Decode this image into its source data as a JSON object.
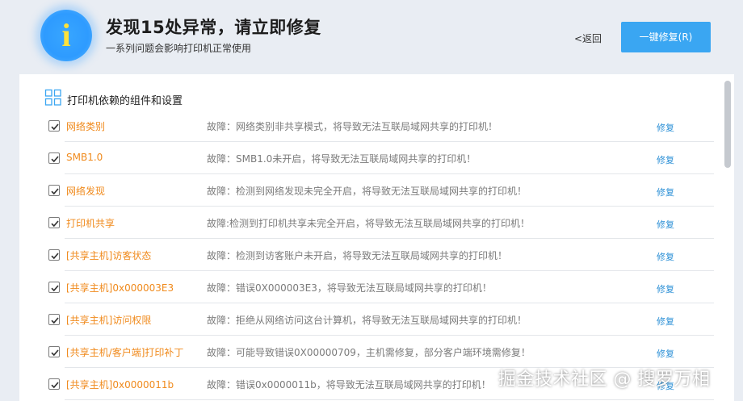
{
  "header": {
    "icon": "info-icon",
    "icon_glyph": "i",
    "title": "发现15处异常，请立即修复",
    "subtitle": "一系列问题会影响打印机正常使用",
    "back_label": "<返回",
    "fix_all_label": "一键修复(R)"
  },
  "section": {
    "icon": "grid-icon",
    "title": "打印机依赖的组件和设置"
  },
  "items": [
    {
      "name": "网络类别",
      "desc": "故障：网络类别非共享模式，将导致无法互联局域网共享的打印机！",
      "fix": "修复",
      "checked": true
    },
    {
      "name": "SMB1.0",
      "desc": "故障：SMB1.0未开启，将导致无法互联局域网共享的打印机！",
      "fix": "修复",
      "checked": true
    },
    {
      "name": "网络发现",
      "desc": "故障：检测到网络发现未完全开启，将导致无法互联局域网共享的打印机！",
      "fix": "修复",
      "checked": true
    },
    {
      "name": "打印机共享",
      "desc": "故障:检测到打印机共享未完全开启，将导致无法互联局域网共享的打印机！",
      "fix": "修复",
      "checked": true
    },
    {
      "name": "[共享主机]访客状态",
      "desc": "故障：检测到访客账户未开启，将导致无法互联局域网共享的打印机！",
      "fix": "修复",
      "checked": true
    },
    {
      "name": "[共享主机]0x000003E3",
      "desc": "故障：错误0X000003E3，将导致无法互联局域网共享的打印机！",
      "fix": "修复",
      "checked": true
    },
    {
      "name": "[共享主机]访问权限",
      "desc": "故障：拒绝从网络访问这台计算机，将导致无法互联局域网共享的打印机！",
      "fix": "修复",
      "checked": true
    },
    {
      "name": "[共享主机/客户端]打印补丁",
      "desc": "故障：可能导致错误0X00000709，主机需修复，部分客户端环境需修复！",
      "fix": "修复",
      "checked": true
    },
    {
      "name": "[共享主机]0x0000011b",
      "desc": "故障：错误0x0000011b，将导致无法互联局域网共享的打印机！",
      "fix": "修复",
      "checked": true
    }
  ],
  "watermark": "掘金技术社区 @ 搜罗万相",
  "colors": {
    "accent": "#3aa6f2",
    "item_name": "#f08a1c",
    "fix_link": "#2a8fd6",
    "info_circle": "#2e9bff",
    "info_glyph": "#ffe23a"
  }
}
